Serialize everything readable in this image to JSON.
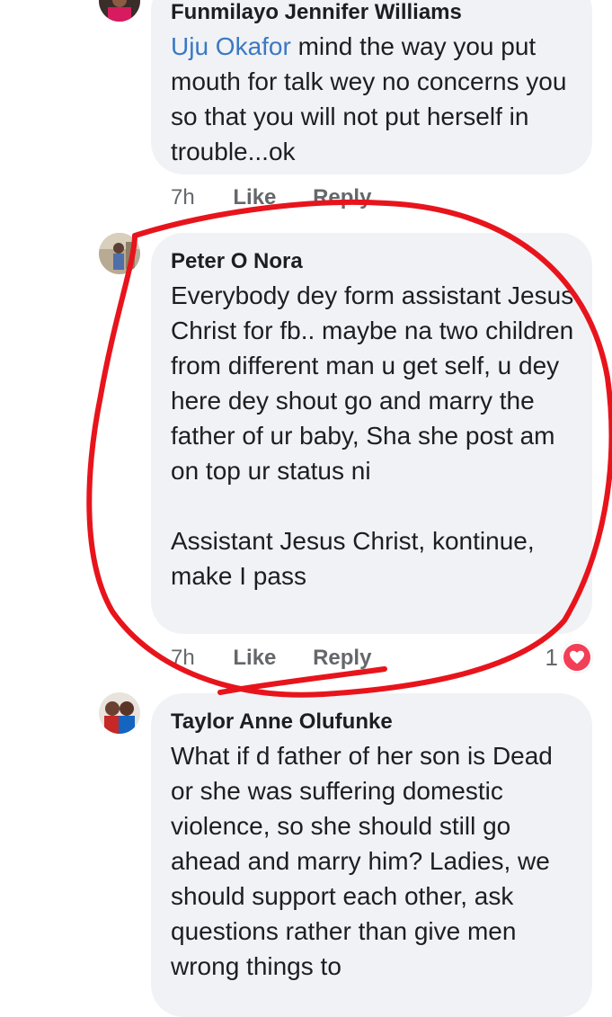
{
  "comments": [
    {
      "author": "Funmilayo Jennifer Williams",
      "mention": "Uju Okafor",
      "text": " mind the way you put mouth for talk wey no concerns you so that you will not put herself in trouble...ok",
      "time": "7h",
      "like_label": "Like",
      "reply_label": "Reply"
    },
    {
      "author": "Peter O Nora",
      "text": "Everybody dey form assistant Jesus Christ for fb.. maybe na two children from different man u get self, u dey here dey shout go and marry the father of ur baby, Sha she post am on top ur status ni\n\nAssistant Jesus Christ, kontinue, make I pass",
      "time": "7h",
      "like_label": "Like",
      "reply_label": "Reply",
      "reaction_count": "1",
      "reaction_icon": "heart-icon"
    },
    {
      "author": "Taylor Anne Olufunke",
      "text": "What if d father of her son is Dead or she was suffering domestic violence, so she should still go ahead and marry him? Ladies, we should support each other, ask questions rather than give men wrong things to"
    }
  ],
  "colors": {
    "bubble": "#f0f2f5",
    "mention": "#3b78c4",
    "meta": "#65676b",
    "annotation": "#e8141c",
    "heart": "#f33e58"
  }
}
